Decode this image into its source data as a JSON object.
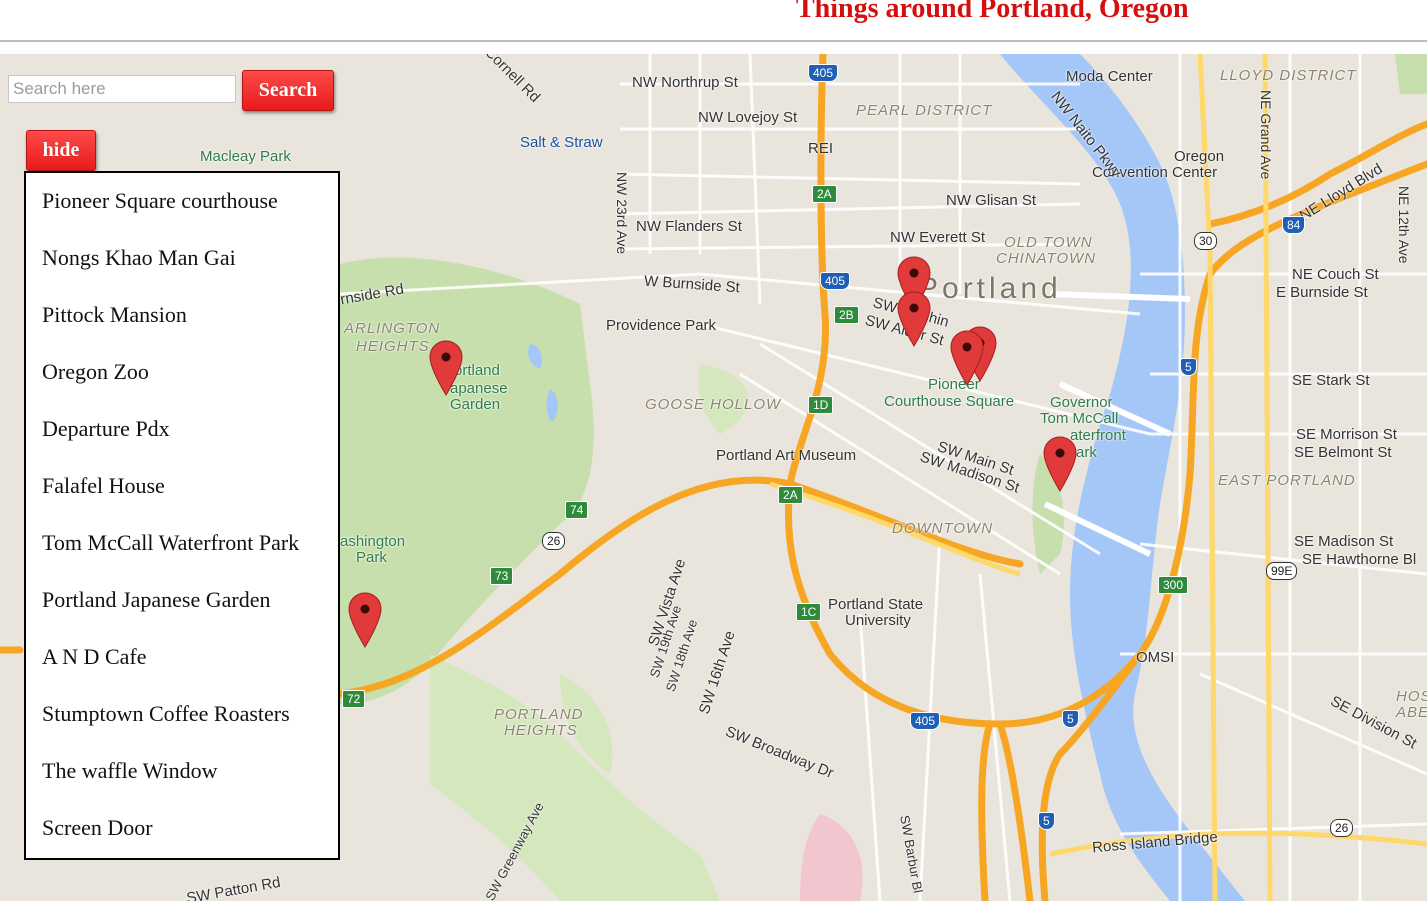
{
  "header": {
    "title": "Things around Portland, Oregon"
  },
  "search": {
    "placeholder": "Search here",
    "button_label": "Search"
  },
  "sidebar": {
    "toggle_label": "hide",
    "places": [
      "Pioneer Square courthouse",
      "Nongs Khao Man Gai",
      "Pittock Mansion",
      "Oregon Zoo",
      "Departure Pdx",
      "Falafel House",
      "Tom McCall Waterfront Park",
      "Portland Japanese Garden",
      "A N D Cafe",
      "Stumptown Coffee Roasters",
      "The waffle Window",
      "Screen Door"
    ]
  },
  "map": {
    "city_label": "Portland",
    "labels": {
      "nw_northrup": "NW Northrup St",
      "nw_lovejoy": "NW Lovejoy St",
      "pearl": "PEARL DISTRICT",
      "salt_straw": "Salt & Straw",
      "rei": "REI",
      "nw_glisan": "NW Glisan St",
      "nw_flanders": "NW Flanders St",
      "nw_everett": "NW Everett St",
      "old_town": "OLD TOWN",
      "chinatown": "CHINATOWN",
      "w_burnside": "W Burnside St",
      "burnside_rd": "rnside Rd",
      "providence_park": "Providence Park",
      "arlington": "ARLINGTON",
      "heights": "HEIGHTS",
      "japanese_garden_1": "ortland",
      "japanese_garden_2": "apanese",
      "japanese_garden_3": "Garden",
      "goose_hollow": "GOOSE HOLLOW",
      "pioneer_1": "Pioneer",
      "pioneer_2": "Courthouse Square",
      "governor_1": "Governor",
      "governor_2": "Tom McCall",
      "governor_3": "aterfront",
      "governor_4": "ark",
      "art_museum": "Portland Art Museum",
      "sw_main": "SW Main St",
      "sw_madison": "SW Madison St",
      "downtown": "DOWNTOWN",
      "washington_park_1": "ashington",
      "washington_park_2": "Park",
      "psu_1": "Portland State",
      "psu_2": "University",
      "portland_heights_1": "PORTLAND",
      "portland_heights_2": "HEIGHTS",
      "sw_broadway": "SW Broadway Dr",
      "sw_vista": "SW Vista Ave",
      "sw_19th": "SW 19th Ave",
      "sw_18th": "SW 18th Ave",
      "sw_16th": "SW 16th Ave",
      "sw_greenway": "SW Greenway Ave",
      "sw_patton": "SW Patton Rd",
      "sw_barbur": "SW Barbur Bl",
      "omsi": "OMSI",
      "ross_island": "Ross Island Bridge",
      "moda": "Moda Center",
      "lloyd": "LLOYD DISTRICT",
      "convention_1": "Oregon",
      "convention_2": "Convention Center",
      "ne_grand": "NE Grand Ave",
      "ne_lloyd": "NE Lloyd Blvd",
      "ne_12th": "NE 12th Ave",
      "ne_couch": "NE Couch St",
      "e_burnside": "E Burnside St",
      "se_stark": "SE Stark St",
      "se_morrison": "SE Morrison St",
      "se_belmont": "SE Belmont St",
      "east_portland": "EAST PORTLAND",
      "se_madison": "SE Madison St",
      "se_hawthorne": "SE Hawthorne Bl",
      "se_division": "SE Division St",
      "hosford_1": "HOSFO",
      "hosford_2": "ABERN",
      "nw_23rd": "NW 23rd Ave",
      "macleay": "Macleay Park",
      "nw_cornell": "NW Cornell Rd",
      "nw_naito": "NW Naito Pkwy",
      "sw_alder": "SW Alder St",
      "sw_washington": "SW Washin"
    },
    "shields": {
      "i405_top": "405",
      "i405_mid": "405",
      "i405_bot": "405",
      "r2a_top": "2A",
      "r2b": "2B",
      "r1d": "1D",
      "r2a_bot": "2A",
      "r1c": "1C",
      "r74": "74",
      "r73": "73",
      "r72": "72",
      "us26_a": "26",
      "us26_b": "26",
      "us30": "30",
      "i84": "84",
      "i5_a": "5",
      "i5_b": "5",
      "i5_c": "5",
      "r300": "300",
      "r99e": "99E"
    },
    "marker_color": "#e03a3a",
    "water_color": "#a5c7f7",
    "park_color": "#c6dfac",
    "highway_color": "#f6a623"
  }
}
